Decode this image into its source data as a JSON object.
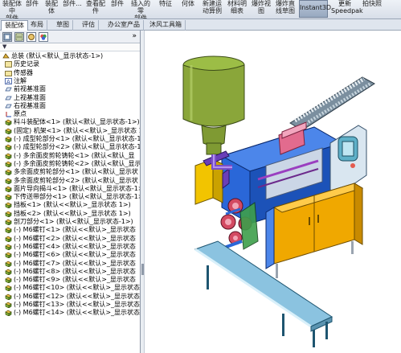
{
  "ribbon": {
    "items": [
      {
        "label": "装配体中\n部件"
      },
      {
        "label": "部件"
      },
      {
        "label": "装配\n体"
      },
      {
        "label": "部件..."
      },
      {
        "label": "查看配\n件"
      },
      {
        "label": "部件"
      },
      {
        "label": "插入的零\n部件"
      },
      {
        "label": "特征"
      },
      {
        "label": "何体"
      },
      {
        "label": "新建运\n动算例"
      },
      {
        "label": "材料明\n细表"
      },
      {
        "label": "爆炸视\n图"
      },
      {
        "label": "爆炸直\n线草图"
      },
      {
        "label": "Instant3D"
      },
      {
        "label": "更新\nSpeedpak"
      },
      {
        "label": "拍快照"
      }
    ]
  },
  "tabs": [
    {
      "label": "装配体"
    },
    {
      "label": "布局"
    },
    {
      "label": "草图"
    },
    {
      "label": "评估"
    },
    {
      "label": "办公室产品"
    },
    {
      "label": "沐风工具箱"
    }
  ],
  "pane": {
    "collapse_label": "»",
    "filter_label": "▼"
  },
  "tree": [
    {
      "icon": "assembly-icon",
      "label": "总装  (默认<默认_显示状态-1>)",
      "indent": 0
    },
    {
      "icon": "history-icon",
      "label": "历史记录",
      "indent": 1
    },
    {
      "icon": "sensor-icon",
      "label": "传感器",
      "indent": 1
    },
    {
      "icon": "annotation-icon",
      "label": "注解",
      "indent": 1
    },
    {
      "icon": "plane-icon",
      "label": "前视基准面",
      "indent": 1
    },
    {
      "icon": "plane-icon",
      "label": "上视基准面",
      "indent": 1
    },
    {
      "icon": "plane-icon",
      "label": "右视基准面",
      "indent": 1
    },
    {
      "icon": "origin-icon",
      "label": "原点",
      "indent": 1
    },
    {
      "icon": "part-icon",
      "label": "料斗装配体<1>  (默认<默认_显示状态-1>)",
      "indent": 1
    },
    {
      "icon": "part-icon",
      "label": "(固定) 机架<1>  (默认<<默认>_显示状态 1>)",
      "indent": 1
    },
    {
      "icon": "part-icon",
      "label": "(-) 成型轮部分<1>  (默认<默认_显示状态-1>)",
      "indent": 1
    },
    {
      "icon": "part-icon",
      "label": "(-) 成型轮部分<2>  (默认<默认_显示状态-1>)",
      "indent": 1
    },
    {
      "icon": "part-icon",
      "label": "(-) 多余面皮剪轮铸轮<1>  (默认<默认_显",
      "indent": 1
    },
    {
      "icon": "part-icon",
      "label": "(-) 多余面皮剪轮铸轮<2>  (默认<默认_显示",
      "indent": 1
    },
    {
      "icon": "part-icon",
      "label": "多余面皮剪轮部分<1>  (默认<默认_显示状",
      "indent": 1
    },
    {
      "icon": "part-icon",
      "label": "多余面皮剪轮部分<2>  (默认<默认_显示状",
      "indent": 1
    },
    {
      "icon": "part-icon",
      "label": "面片导向揭斗<1>  (默认<默认_显示状态-1>)",
      "indent": 1
    },
    {
      "icon": "part-icon",
      "label": "下传送带部分<1>  (默认<默认_显示状态-1>)",
      "indent": 1
    },
    {
      "icon": "part-icon",
      "label": "挡板<1>  (默认<<默认>_显示状态 1>)",
      "indent": 1
    },
    {
      "icon": "part-icon",
      "label": "挡板<2>  (默认<<默认>_显示状态 1>)",
      "indent": 1
    },
    {
      "icon": "part-icon",
      "label": "剖刀部分<1>  (默认<默认_显示状态-1>)",
      "indent": 1
    },
    {
      "icon": "part-icon",
      "label": "(-) M6螺钉<1>  (默认<<默认>_显示状态",
      "indent": 1
    },
    {
      "icon": "part-icon",
      "label": "(-) M6螺钉<2>  (默认<<默认>_显示状态",
      "indent": 1
    },
    {
      "icon": "part-icon",
      "label": "(-) M6螺钉<4>  (默认<<默认>_显示状态",
      "indent": 1
    },
    {
      "icon": "part-icon",
      "label": "(-) M6螺钉<6>  (默认<<默认>_显示状态",
      "indent": 1
    },
    {
      "icon": "part-icon",
      "label": "(-) M6螺钉<7>  (默认<<默认>_显示状态",
      "indent": 1
    },
    {
      "icon": "part-icon",
      "label": "(-) M6螺钉<8>  (默认<<默认>_显示状态",
      "indent": 1
    },
    {
      "icon": "part-icon",
      "label": "(-) M6螺钉<9>  (默认<<默认>_显示状态",
      "indent": 1
    },
    {
      "icon": "part-icon",
      "label": "(-) M6螺钉<10>  (默认<<默认>_显示状态",
      "indent": 1
    },
    {
      "icon": "part-icon",
      "label": "(-) M6螺钉<12>  (默认<<默认>_显示状态",
      "indent": 1
    },
    {
      "icon": "part-icon",
      "label": "(-) M6螺钉<13>  (默认<<默认>_显示状态",
      "indent": 1
    },
    {
      "icon": "part-icon",
      "label": "(-) M6螺钉<14>  (默认<<默认>_显示状态",
      "indent": 1
    }
  ],
  "colors": {
    "hopper": "#8aa63a",
    "frame": "#1f5fd6",
    "cabinet": "#f0a800",
    "conveyor": "#8bc3e0",
    "rollers": "#d34a62",
    "panel": "#5fb0c8"
  }
}
